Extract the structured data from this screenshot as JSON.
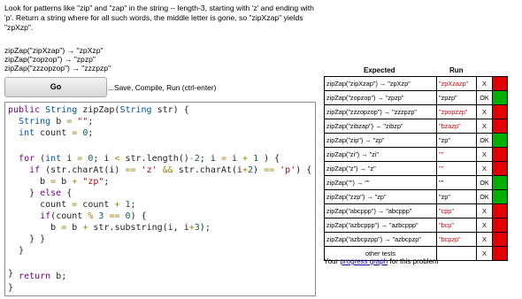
{
  "description": "Look for patterns like \"zip\" and \"zap\" in the string -- length-3, starting with 'z' and ending with 'p'. Return a string where for all such words, the middle letter is gone, so \"zipXzap\" yields \"zpXzp\".",
  "examples": [
    "zipZap(\"zipXzap\") → \"zpXzp\"",
    "zipZap(\"zopzop\") → \"zpzp\"",
    "zipZap(\"zzzopzop\") → \"zzzpzp\""
  ],
  "go_button": "Go",
  "go_hint": "...Save, Compile, Run (ctrl-enter)",
  "results_header": {
    "expected": "Expected",
    "run": "Run"
  },
  "results": [
    {
      "expected": "zipZap(\"zipXzap\") → \"zpXzp\"",
      "run": "\"zpXzazp\"",
      "status": "X",
      "color": "#e00000",
      "wrong": true
    },
    {
      "expected": "zipZap(\"zopzop\") → \"zpzp\"",
      "run": "\"zpzp\"",
      "status": "OK",
      "color": "#00b000",
      "wrong": false
    },
    {
      "expected": "zipZap(\"zzzopzop\") → \"zzzpzp\"",
      "run": "\"zpopzzp\"",
      "status": "X",
      "color": "#e00000",
      "wrong": true
    },
    {
      "expected": "zipZap(\"zibzap\") → \"zibzp\"",
      "run": "\"bzazp\"",
      "status": "X",
      "color": "#e00000",
      "wrong": true
    },
    {
      "expected": "zipZap(\"zip\") → \"zp\"",
      "run": "\"zp\"",
      "status": "OK",
      "color": "#00b000",
      "wrong": false
    },
    {
      "expected": "zipZap(\"zi\") → \"zi\"",
      "run": "\"\"",
      "status": "X",
      "color": "#e00000",
      "wrong": true
    },
    {
      "expected": "zipZap(\"z\") → \"z\"",
      "run": "\"\"",
      "status": "X",
      "color": "#e00000",
      "wrong": true
    },
    {
      "expected": "zipZap(\"\") → \"\"",
      "run": "\"\"",
      "status": "OK",
      "color": "#00b000",
      "wrong": false
    },
    {
      "expected": "zipZap(\"zzp\") → \"zp\"",
      "run": "\"zp\"",
      "status": "OK",
      "color": "#00b000",
      "wrong": false
    },
    {
      "expected": "zipZap(\"abcppp\") → \"abcppp\"",
      "run": "\"cpp\"",
      "status": "X",
      "color": "#e00000",
      "wrong": true
    },
    {
      "expected": "zipZap(\"azbcppp\") → \"azbcppp\"",
      "run": "\"bcp\"",
      "status": "X",
      "color": "#e00000",
      "wrong": true
    },
    {
      "expected": "zipZap(\"azbcpzpp\") → \"azbcpzp\"",
      "run": "\"bcpzp\"",
      "status": "X",
      "color": "#e00000",
      "wrong": true
    },
    {
      "expected": "other tests",
      "run": "",
      "status": "X",
      "color": "#e00000",
      "wrong": false
    }
  ],
  "graph_prefix": "Your ",
  "graph_link": "progress graph",
  "graph_suffix": " for this problem",
  "code": [
    "public String zipZap(String str) {",
    "  String b = \"\";",
    "  int count = 0;",
    "",
    "  for (int i = 0; i < str.length()-2; i = i + 1 ) {",
    "    if (str.charAt(i) == 'z' && str.charAt(i+2) == 'p') {",
    "      b = b + \"zp\";",
    "    } else {",
    "      count = count + 1;",
    "      if(count % 3 == 0) {",
    "        b = b + str.substring(i, i+3);",
    "      }",
    "    }",
    "  }",
    "",
    "  return b;",
    "}"
  ]
}
